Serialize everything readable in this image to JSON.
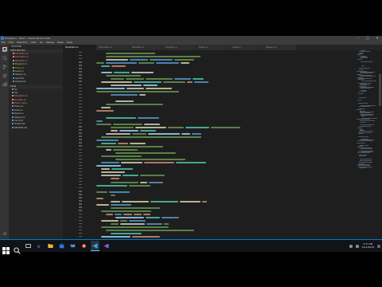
{
  "window": {
    "title": "Exception - Exam - Visual Studio Code",
    "min": "–",
    "max": "▢",
    "close": "✕"
  },
  "menu": [
    "File",
    "Edit",
    "Selection",
    "View",
    "Go",
    "Debug",
    "Tasks",
    "Help"
  ],
  "sidebar": {
    "header": "EXPLORER",
    "open_editors": "OPEN EDITORS",
    "open_items": [
      {
        "label": "Exception.cs",
        "state": "err"
      },
      {
        "label": "Calculator.cs",
        "state": "err"
      },
      {
        "label": "ParseFile.cs",
        "state": "err"
      },
      {
        "label": "Program.cs",
        "state": "normal"
      },
      {
        "label": "Token.cs",
        "state": "warn"
      },
      {
        "label": "Lexer.cs",
        "state": "normal"
      },
      {
        "label": "Helpers.cs",
        "state": "normal"
      },
      {
        "label": "Input.txt",
        "state": "normal"
      },
      {
        "label": "Output.txt",
        "state": "normal"
      }
    ],
    "project_section": "EXAM",
    "project_items": [
      {
        "label": "bin",
        "state": "normal"
      },
      {
        "label": "obj",
        "state": "normal"
      },
      {
        "label": "Exception.cs",
        "state": "err"
      },
      {
        "label": "Program.cs",
        "state": "err"
      },
      {
        "label": "Exam.csproj",
        "state": "err"
      },
      {
        "label": "Token.cs",
        "state": "normal"
      },
      {
        "label": "Lexer.cs",
        "state": "normal"
      },
      {
        "label": "Parser.cs",
        "state": "normal"
      },
      {
        "label": "Helpers.cs",
        "state": "normal"
      },
      {
        "label": "Input.txt",
        "state": "normal"
      },
      {
        "label": "Output.txt",
        "state": "normal"
      },
      {
        "label": "README.md",
        "state": "normal"
      }
    ]
  },
  "tabs": [
    {
      "label": "Exception.cs",
      "active": true
    },
    {
      "label": "Calculator.cs",
      "active": false
    },
    {
      "label": "ParseFile.cs",
      "active": false
    },
    {
      "label": "Program.cs",
      "active": false
    },
    {
      "label": "Token.cs",
      "active": false
    },
    {
      "label": "Lexer.cs",
      "active": false
    },
    {
      "label": "Helpers.cs",
      "active": false
    }
  ],
  "status": {
    "left": "⊗ 0  ⚠ 0",
    "ln_col": "Ln 115, Col 1",
    "spaces": "Spaces: 4",
    "encoding": "UTF-8",
    "eol": "CRLF",
    "language": "C#"
  },
  "taskbar": {
    "time": "4:31 PM",
    "date": "3/21/2018"
  },
  "colors": {
    "accent": "#007acc",
    "keyword": "#569cd6",
    "string": "#ce9178",
    "comment": "#6a9955",
    "identifier": "#9cdcfe",
    "type": "#4ec9b0",
    "plain": "#d4d4d4",
    "method": "#dcdcaa"
  }
}
